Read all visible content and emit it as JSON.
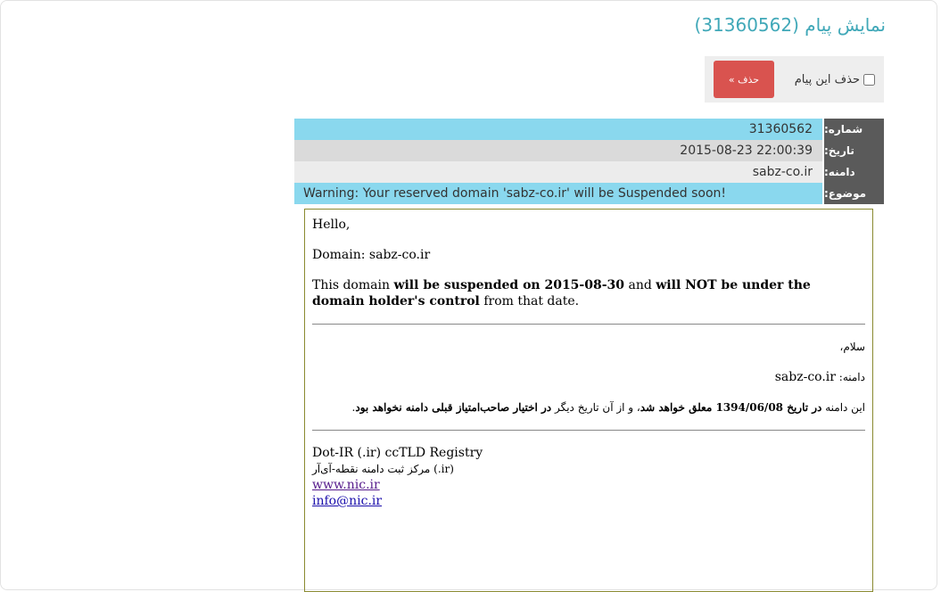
{
  "page": {
    "title": "نمایش پیام (31360562)"
  },
  "delete_bar": {
    "checkbox_label": "حذف این پیام",
    "button_label": "حذف »"
  },
  "meta": {
    "number": {
      "label": "شماره:",
      "value": "31360562"
    },
    "date": {
      "label": "تاریخ:",
      "value": "2015-08-23 22:00:39"
    },
    "domain": {
      "label": "دامنه:",
      "value": "sabz-co.ir"
    },
    "subject": {
      "label": "موضوع:",
      "value": "Warning: Your reserved domain 'sabz-co.ir' will be Suspended soon!"
    }
  },
  "message": {
    "en": {
      "greeting": "Hello,",
      "domain_line": "Domain: sabz-co.ir",
      "body_pre": "This domain ",
      "body_bold1": "will be suspended on 2015-08-30",
      "body_mid": " and ",
      "body_bold2": "will NOT be under the domain holder's control",
      "body_post": " from that date."
    },
    "fa": {
      "greeting": "سلام،",
      "domain_label": "دامنه: ",
      "domain_value": "sabz-co.ir",
      "body_pre": "این دامنه ",
      "body_bold1": "در تاریخ 1394/06/08 معلق خواهد شد",
      "body_mid": "، و از آن تاریخ دیگر ",
      "body_bold2": "در اختیار صاحب‌امتیاز قبلی دامنه نخواهد بود",
      "body_post": "."
    },
    "signature": {
      "line1": "Dot-IR (.ir) ccTLD Registry",
      "line2": "مرکز ثبت دامنه نقطه-آی‌آر (.ir)",
      "link1": "www.nic.ir",
      "link2": "info@nic.ir"
    }
  }
}
